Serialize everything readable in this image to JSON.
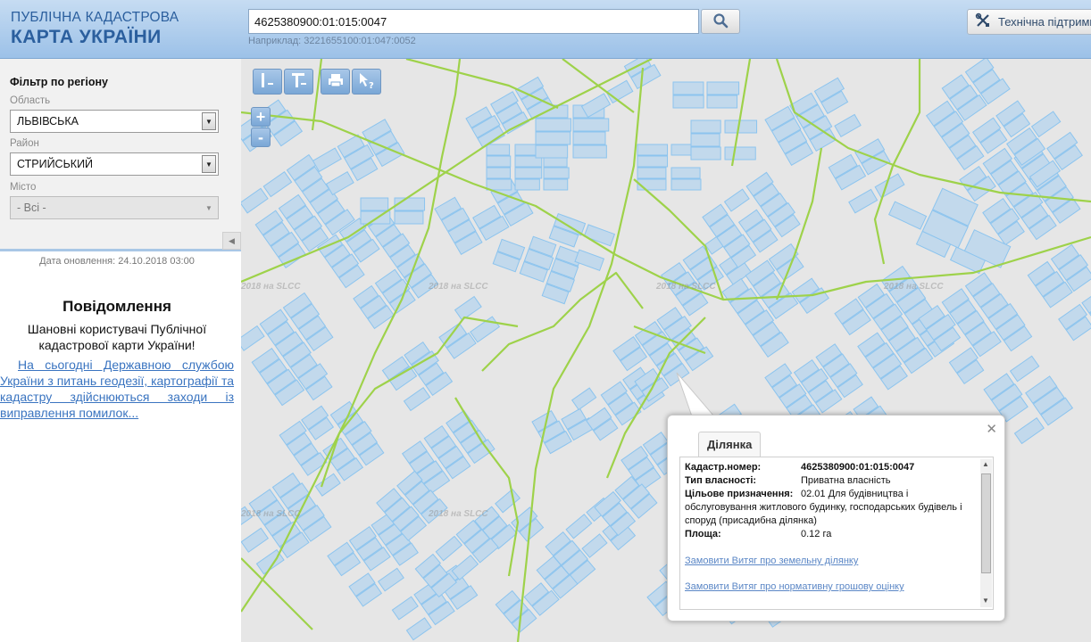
{
  "header": {
    "logo_line1": "ПУБЛІЧНА КАДАСТРОВА",
    "logo_line2": "КАРТА УКРАЇНИ",
    "search_value": "4625380900:01:015:0047",
    "search_example": "Наприклад: 3221655100:01:047:0052",
    "support_label": "Технічна підтримка"
  },
  "sidebar": {
    "filter_title": "Фільтр по регіону",
    "oblast_label": "Область",
    "oblast_value": "ЛЬВІВСЬКА",
    "raion_label": "Район",
    "raion_value": "СТРИЙСЬКИЙ",
    "misto_label": "Місто",
    "misto_value": "- Всі -",
    "update_date": "Дата оновлення: 24.10.2018 03:00",
    "message_title": "Повідомлення",
    "message_text": "Шановні користувачі Публічної кадастрової карти України!",
    "message_link": "На сьогодні Державною службою України з питань геодезії, картографії та кадастру здійснюються заходи із виправлення помилок..."
  },
  "map": {
    "watermark": "2018 на SLCC",
    "zoom_in": "+",
    "zoom_out": "-"
  },
  "popup": {
    "tab": "Ділянка",
    "cadastr_label": "Кадастр.номер:",
    "cadastr_value": "4625380900:01:015:0047",
    "ownership_label": "Тип власності:",
    "ownership_value": "Приватна власність",
    "purpose_label": "Цільове призначення:",
    "purpose_value_line1": "02.01 Для будівництва і",
    "purpose_value_line2": "обслуговування житлового будинку, господарських будівель і",
    "purpose_value_line3": "споруд (присадибна ділянка)",
    "area_label": "Площа:",
    "area_value": "0.12 га",
    "link1": "Замовити Витяг про земельну ділянку",
    "link2": "Замовити Витяг про нормативну грошову оцінку"
  },
  "colors": {
    "parcel_fill": "#c2d9ec",
    "parcel_stroke": "#8cc4ee",
    "boundary": "#9ed24a",
    "map_bg": "#e6e6e6"
  }
}
